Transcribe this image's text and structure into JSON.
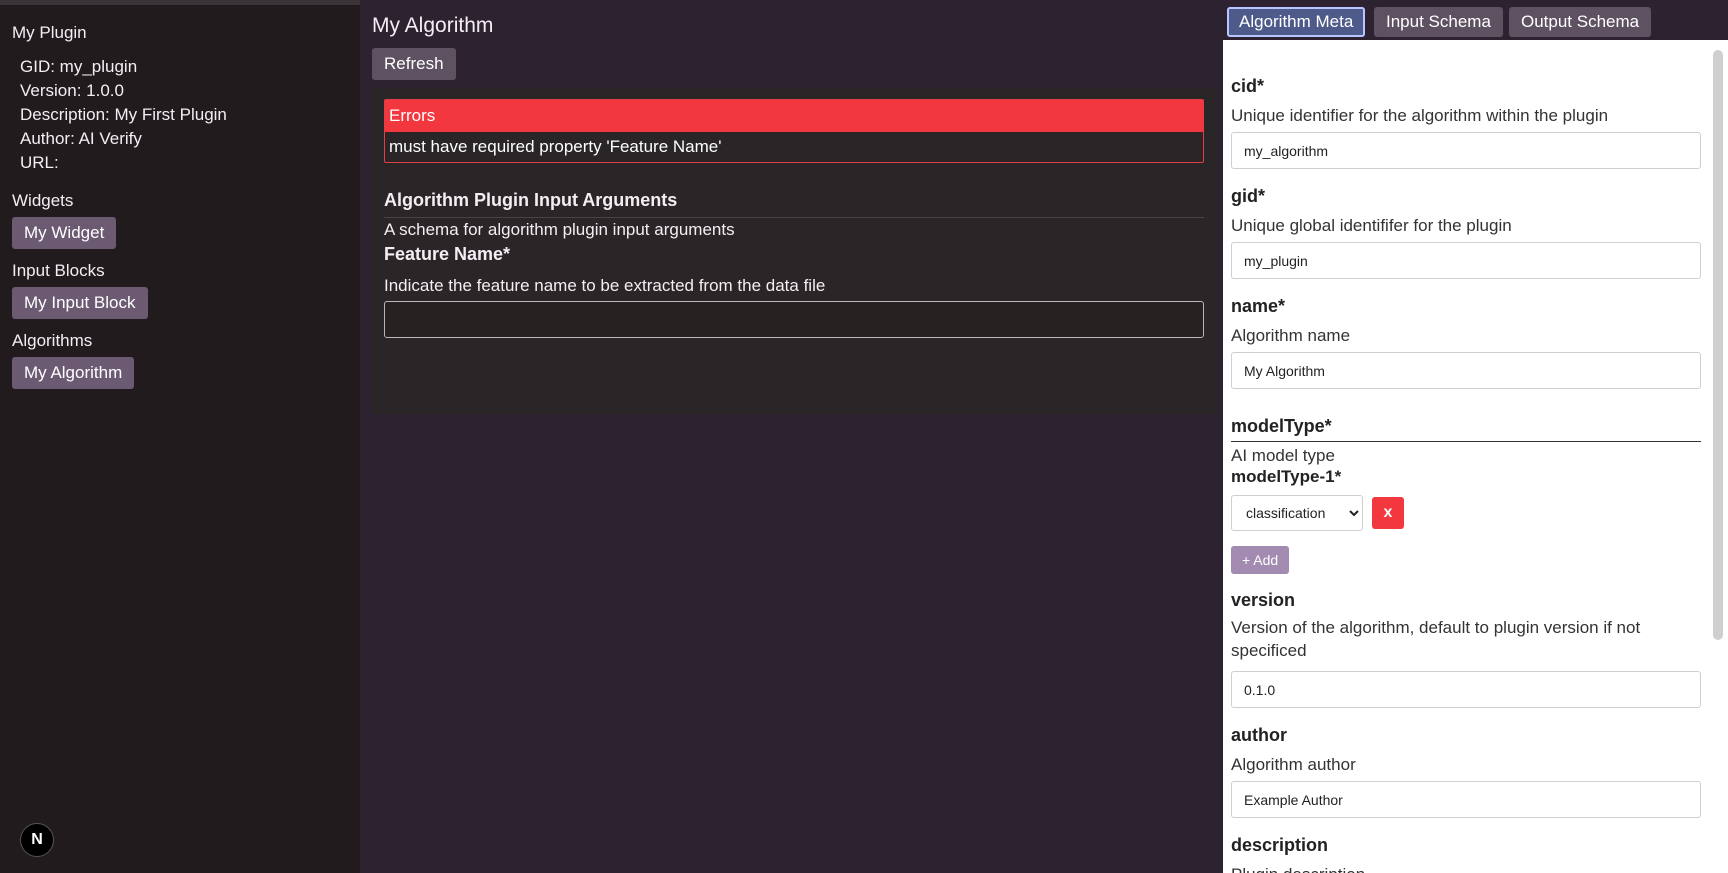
{
  "sidebar": {
    "plugin_title": "My Plugin",
    "meta": [
      "GID: my_plugin",
      "Version: 1.0.0",
      "Description: My First Plugin",
      "Author: AI Verify",
      "URL:"
    ],
    "widgets_heading": "Widgets",
    "widget_button": "My Widget",
    "input_blocks_heading": "Input Blocks",
    "input_block_button": "My Input Block",
    "algorithms_heading": "Algorithms",
    "algorithm_button": "My Algorithm",
    "badge": "N"
  },
  "main": {
    "title": "My Algorithm",
    "refresh_label": "Refresh",
    "errors_heading": "Errors",
    "error_message": "must have required property 'Feature Name'",
    "schema_title": "Algorithm Plugin Input Arguments",
    "schema_description": "A schema for algorithm plugin input arguments",
    "field_title": "Feature Name*",
    "field_description": "Indicate the feature name to be extracted from the data file",
    "field_value": ""
  },
  "tabs": [
    "Algorithm Meta",
    "Input Schema",
    "Output Schema"
  ],
  "meta": {
    "cid_label": "cid*",
    "cid_desc": "Unique identifier for the algorithm within the plugin",
    "cid_value": "my_algorithm",
    "gid_label": "gid*",
    "gid_desc": "Unique global identififer for the plugin",
    "gid_value": "my_plugin",
    "name_label": "name*",
    "name_desc": "Algorithm name",
    "name_value": "My Algorithm",
    "modeltype_label": "modelType*",
    "modeltype_desc": "AI model type",
    "modeltype1_label": "modelType-1*",
    "modeltype1_value": "classification",
    "remove_label": "x",
    "add_label": "+ Add",
    "version_label": "version",
    "version_desc": "Version of the algorithm, default to plugin version if not specificed",
    "version_value": "0.1.0",
    "author_label": "author",
    "author_desc": "Algorithm author",
    "author_value": "Example Author",
    "description_label": "description",
    "description_desc": "Plugin description"
  },
  "colors": {
    "error": "#f2373f",
    "button": "#6b5a72",
    "active_tab": "#4e5a8a"
  }
}
